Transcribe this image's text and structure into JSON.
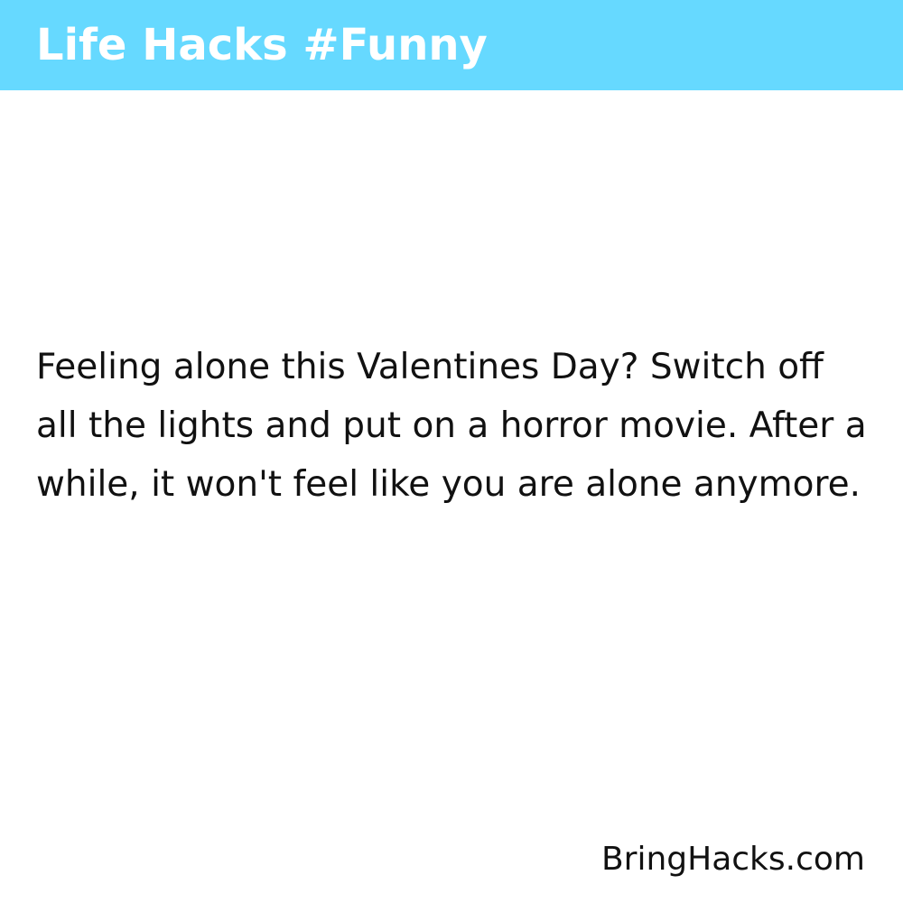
{
  "header": {
    "title": "Life Hacks #Funny",
    "band_color": "#66d9ff",
    "text_color": "#ffffff"
  },
  "main": {
    "hack_text": "Feeling alone this Valentines Day? Switch off all the lights and put on a horror movie. After a while, it won't feel like you are alone anymore.",
    "text_color": "#111111"
  },
  "footer": {
    "brand": "BringHacks.com"
  },
  "background_color": "#ffffff"
}
